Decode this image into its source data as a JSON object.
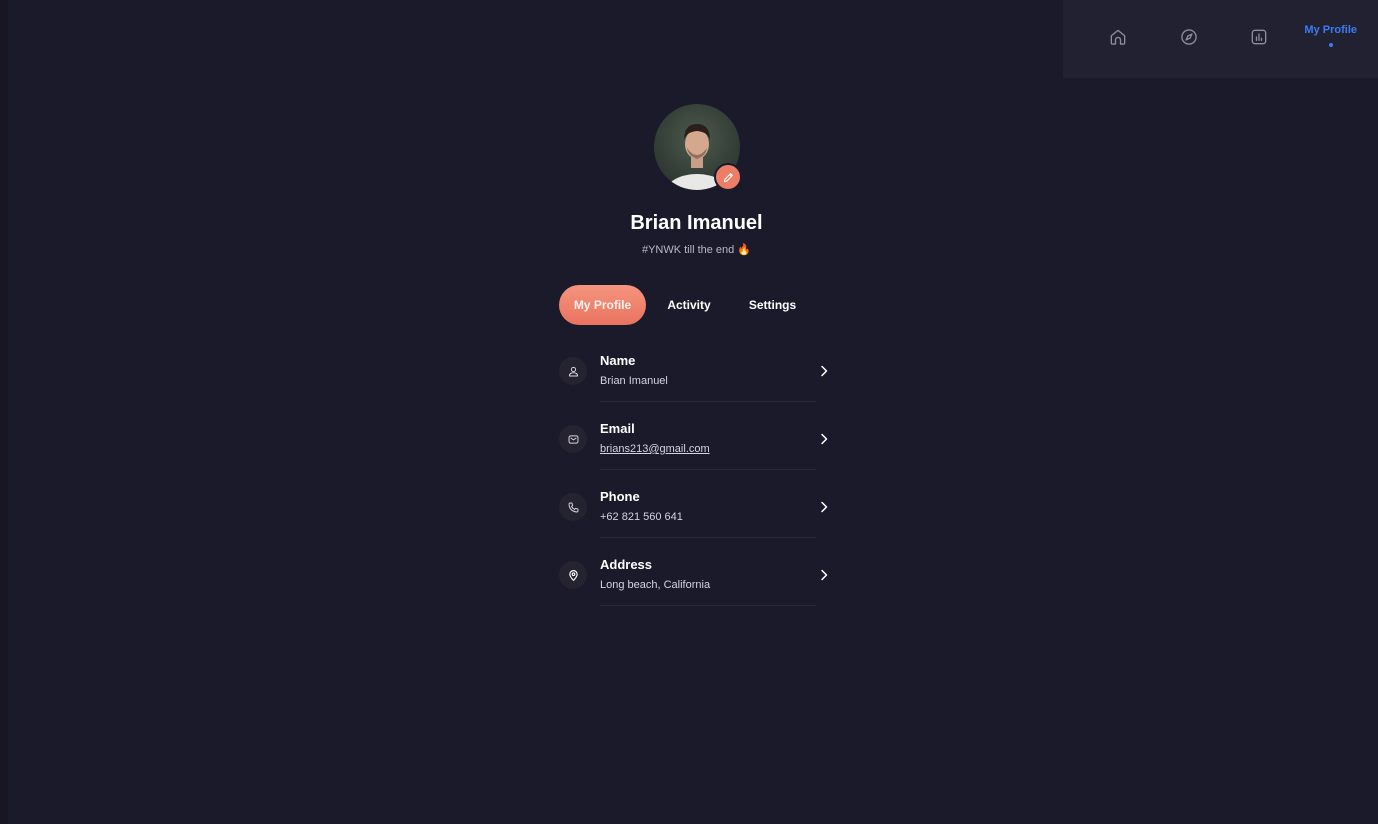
{
  "nav": {
    "items": [
      {
        "icon": "home-icon"
      },
      {
        "icon": "compass-icon"
      },
      {
        "icon": "chart-icon"
      }
    ],
    "active_label": "My Profile",
    "accent": "#3b7cf6"
  },
  "profile": {
    "name": "Brian Imanuel",
    "bio": "#YNWK till the end",
    "bio_emoji": "🔥",
    "avatar_icon": "avatar-photo",
    "edit_icon": "pencil-icon"
  },
  "tabs": {
    "items": [
      "My Profile",
      "Activity",
      "Settings"
    ],
    "active": "My Profile",
    "accent": "#ee7d68"
  },
  "info": [
    {
      "label": "Name",
      "value": "Brian Imanuel",
      "icon": "user-icon"
    },
    {
      "label": "Email",
      "value": "brians213@gmail.com",
      "icon": "mail-icon"
    },
    {
      "label": "Phone",
      "value": "+62 821 560 641",
      "icon": "phone-icon"
    },
    {
      "label": "Address",
      "value": "Long beach, California",
      "icon": "location-pin-icon"
    }
  ]
}
